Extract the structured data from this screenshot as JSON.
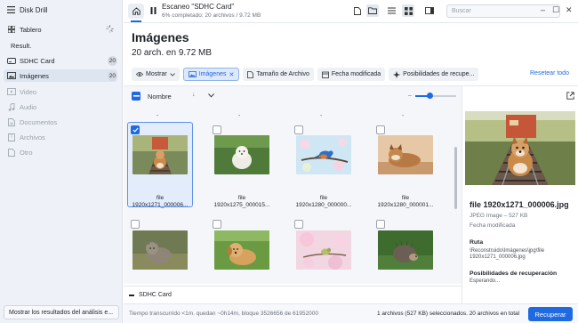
{
  "app": {
    "title": "Disk Drill"
  },
  "sidebar": {
    "dashboard": "Tablero",
    "section": "Result.",
    "items": [
      {
        "label": "SDHC Card",
        "count": "20"
      },
      {
        "label": "Imágenes",
        "count": "20"
      },
      {
        "label": "Video"
      },
      {
        "label": "Audio"
      },
      {
        "label": "Documentos"
      },
      {
        "label": "Archivos"
      },
      {
        "label": "Otro"
      }
    ],
    "bottom_button": "Mostrar los resultados del análisis e..."
  },
  "topbar": {
    "scan_title": "Escaneo \"SDHC Card\"",
    "scan_progress": "6% completado: 20 archivos / 9.72 MB",
    "search_placeholder": "Buscar"
  },
  "page": {
    "title": "Imágenes",
    "subtitle": "20 arch. en 9.72 MB"
  },
  "filters": {
    "show": "Mostrar",
    "images": "Imágenes",
    "file_size": "Tamaño de Archivo",
    "modified_date": "Fecha modificada",
    "recovery_chances": "Posibilidades de recupe...",
    "reset": "Resetear todo"
  },
  "list": {
    "sort_label": "Nombre",
    "sort_arrow": "↓",
    "zoom_level": 0.35,
    "separator": "-",
    "tiles": [
      {
        "line1": "file",
        "line2": "1920x1271_000006...",
        "selected": true
      },
      {
        "line1": "file",
        "line2": "1920x1275_000015..."
      },
      {
        "line1": "file",
        "line2": "1920x1280_000000..."
      },
      {
        "line1": "file",
        "line2": "1920x1280_000001..."
      },
      {
        "line1": "",
        "line2": ""
      },
      {
        "line1": "",
        "line2": ""
      },
      {
        "line1": "",
        "line2": ""
      },
      {
        "line1": "",
        "line2": ""
      }
    ]
  },
  "source": {
    "label": "SDHC Card"
  },
  "status": {
    "left": "Tiempo transcurrido <1m. quedan ~0h14m, bloque 3526656 de 61952000",
    "right": "1 archivos (527 KB) seleccionados. 20 archivos en total",
    "recover": "Recuperar"
  },
  "preview": {
    "filename": "file 1920x1271_000006.jpg",
    "type": "JPEG Image – 527 KB",
    "date": "Fecha modificada",
    "path_label": "Ruta",
    "path_line1": "\\Reconstruido\\Imágenes\\jpg\\file",
    "path_line2": "1920x1271_000006.jpg",
    "chances_label": "Posibilidades de recuperación",
    "chances_value": "Esperando..."
  },
  "colors": {
    "accent": "#1f6ae0",
    "sidebar_bg": "#eef2f8",
    "grid_bg": "#f4f6f9"
  }
}
